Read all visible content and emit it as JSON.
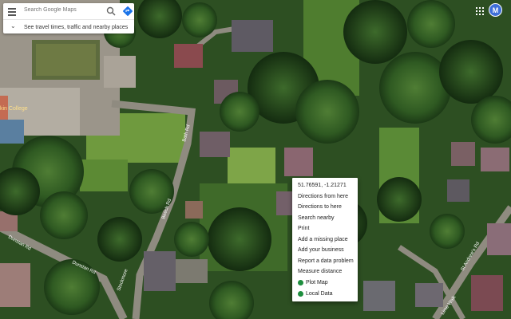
{
  "search": {
    "placeholder": "Search Google Maps",
    "travel_link": "See travel times, traffic and nearby places"
  },
  "icons": {
    "menu": "hamburger-menu-icon",
    "search": "search-icon",
    "directions": "directions-icon",
    "expand": "chevron-down-icon",
    "apps": "apps-grid-icon",
    "local_data": "layers-icon"
  },
  "account": {
    "initial": "M",
    "color": "#3f6fd8"
  },
  "map_labels": {
    "college": "kin College",
    "road1": "Bath Rd",
    "road2": "Beech Rd",
    "road3": "Dunstan Rd",
    "road4": "Dunstan Rd",
    "road5": "Stockmore",
    "road6": "St Andrew's Rd",
    "road7": "Lime Walk"
  },
  "context_menu": {
    "coordinates": "51.76591, -1.21271",
    "items": [
      "Directions from here",
      "Directions to here",
      "Search nearby",
      "Print",
      "Add a missing place",
      "Add your business",
      "Report a data problem",
      "Measure distance"
    ],
    "plugins": [
      "Plot Map",
      "Local Data"
    ]
  },
  "colors": {
    "accent_blue": "#1a73e8",
    "plugin_green": "#1e8e3e"
  }
}
